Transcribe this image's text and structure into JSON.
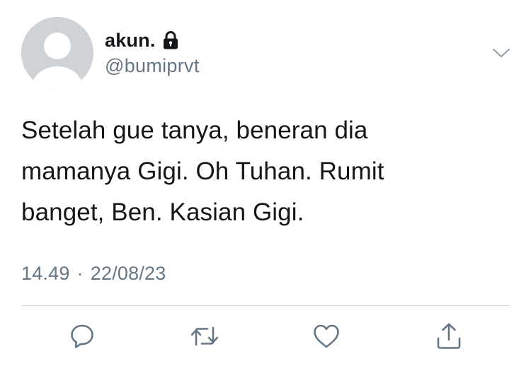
{
  "tweet": {
    "author": {
      "display_name": "akun.",
      "handle": "@bumiprvt",
      "avatar_icon": "default-avatar-icon",
      "protected_icon": "lock-icon"
    },
    "text": "Setelah gue tanya, beneran dia\nmamanya Gigi. Oh Tuhan. Rumit\nbanget, Ben. Kasian Gigi.",
    "time": "14.49",
    "separator": "·",
    "date": "22/08/23",
    "menu_icon": "chevron-down-icon",
    "actions": {
      "reply_icon": "reply-icon",
      "retweet_icon": "retweet-icon",
      "like_icon": "heart-icon",
      "share_icon": "share-icon"
    }
  },
  "colors": {
    "text_primary": "#14171a",
    "text_secondary": "#657786",
    "icon": "#657786",
    "avatar_bg": "#cfd3d6",
    "divider": "#d6dadd"
  }
}
